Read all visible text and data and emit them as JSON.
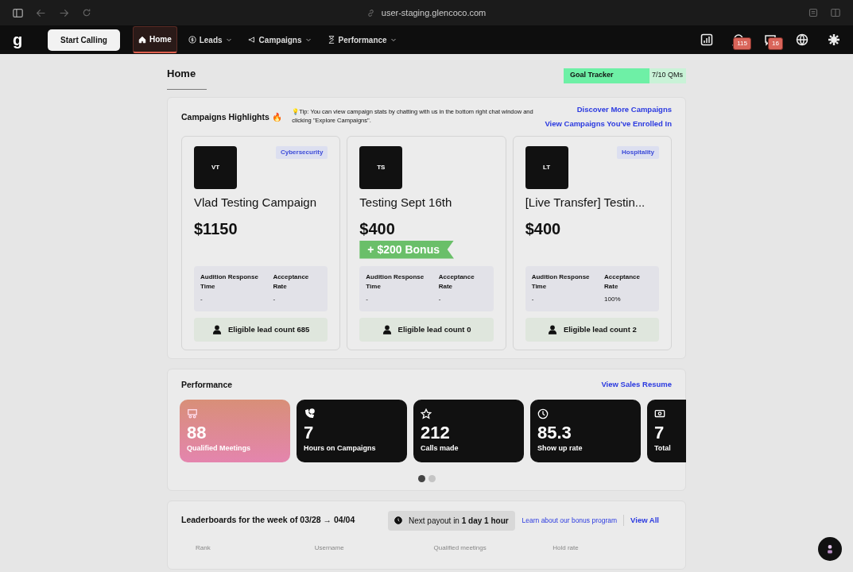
{
  "browser": {
    "url": "user-staging.glencoco.com"
  },
  "navbar": {
    "logo": "g",
    "start_button": "Start Calling",
    "items": [
      {
        "label": "Home",
        "selected": true,
        "dropdown": false
      },
      {
        "label": "Leads",
        "selected": false,
        "dropdown": true
      },
      {
        "label": "Campaigns",
        "selected": false,
        "dropdown": true
      },
      {
        "label": "Performance",
        "selected": false,
        "dropdown": true
      }
    ],
    "badges": [
      "115",
      "16"
    ]
  },
  "page_title": "Home",
  "goal_tracker": {
    "label": "Goal Tracker",
    "reading": "7/10 QMs",
    "level": 0.7
  },
  "campaigns": {
    "title": "Campaigns Highlights 🔥",
    "tip": "💡Tip: You can view campaign stats by chatting with us in the bottom right chat window and clicking \"Explore Campaigns\".",
    "links": [
      "Discover More Campaigns",
      "View Campaigns You've Enrolled In"
    ],
    "cards": [
      {
        "initials": "VT",
        "tag": "Cybersecurity",
        "name": "Vlad Testing Campaign",
        "payout": "$1150",
        "stats": [
          {
            "label": "Audition Response Time",
            "value": "-"
          },
          {
            "label": "Acceptance Rate",
            "value": "-"
          }
        ],
        "leads": "Eligible lead count 685"
      },
      {
        "initials": "TS",
        "name": "Testing Sept 16th",
        "payout": "$400",
        "bonus": "+ $200 Bonus",
        "stats": [
          {
            "label": "Audition Response Time",
            "value": "-"
          },
          {
            "label": "Acceptance Rate",
            "value": "-"
          }
        ],
        "leads": "Eligible lead count 0"
      },
      {
        "initials": "LT",
        "tag": "Hospitality",
        "name": "[Live Transfer] Testin...",
        "payout": "$400",
        "stats": [
          {
            "label": "Audition Response Time",
            "value": "-"
          },
          {
            "label": "Acceptance Rate",
            "value": "100%"
          }
        ],
        "leads": "Eligible lead count 2"
      }
    ]
  },
  "performance": {
    "title": "Performance",
    "link": "View Sales Resume",
    "cards": [
      {
        "value": "88",
        "label": "Qualified Meetings",
        "highlight": true
      },
      {
        "value": "7",
        "label": "Hours on Campaigns",
        "highlight": false
      },
      {
        "value": "212",
        "label": "Calls made",
        "highlight": false
      },
      {
        "value": "85.3",
        "label": "Show up rate",
        "highlight": false
      },
      {
        "value": "7",
        "label": "Total",
        "highlight": false
      }
    ],
    "dots": [
      {
        "selected": true
      },
      {
        "selected": false
      }
    ]
  },
  "leaderboard": {
    "title": "Leaderboards for the week of 03/28 → 04/04",
    "payout_prefix": "Next payout in **1 day 1 hour**",
    "bonus_link": "Learn about our bonus program",
    "view_all": "View All",
    "columns": [
      "Rank",
      "Username",
      "Qualified meetings",
      "Hold rate"
    ]
  }
}
